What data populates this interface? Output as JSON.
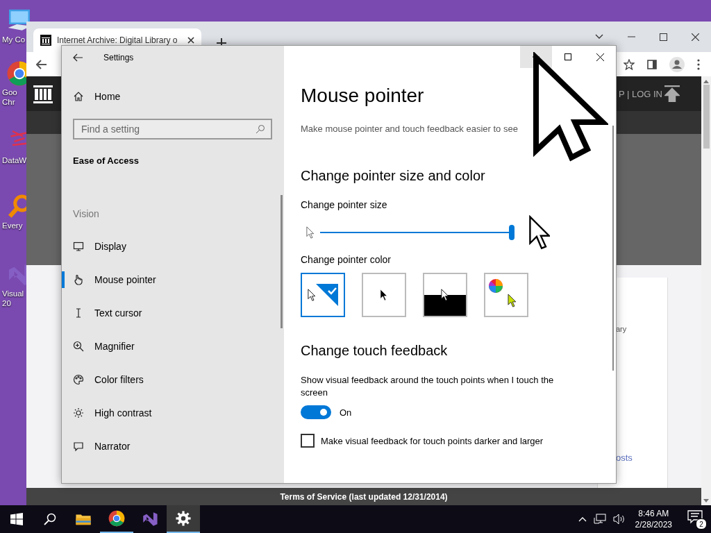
{
  "desktop_icons": [
    {
      "kind": "computer",
      "lines": [
        "My Co"
      ]
    },
    {
      "kind": "browser",
      "lines": [
        "Goo",
        "Chr"
      ]
    },
    {
      "kind": "data",
      "lines": [
        "DataW"
      ]
    },
    {
      "kind": "finder",
      "lines": [
        "Every"
      ]
    },
    {
      "kind": "studio",
      "lines": [
        "Visual",
        "20"
      ]
    }
  ],
  "browser": {
    "tabs": [
      {
        "title": "Internet Archive: Digital Library o",
        "selected": true
      }
    ],
    "header_link": "P | LOG IN",
    "card_text": "ary",
    "card_link": "osts",
    "footer": "Terms of Service (last updated 12/31/2014)"
  },
  "settings": {
    "title": "Settings",
    "home": "Home",
    "search": {
      "placeholder": "Find a setting"
    },
    "category": "Ease of Access",
    "group": "Vision",
    "nav_items": [
      {
        "kind": "display",
        "label": "Display",
        "selected": false
      },
      {
        "kind": "pointer",
        "label": "Mouse pointer",
        "selected": true
      },
      {
        "kind": "cursor",
        "label": "Text cursor",
        "selected": false
      },
      {
        "kind": "magnifier",
        "label": "Magnifier",
        "selected": false
      },
      {
        "kind": "filters",
        "label": "Color filters",
        "selected": false
      },
      {
        "kind": "contrast",
        "label": "High contrast",
        "selected": false
      },
      {
        "kind": "narrator",
        "label": "Narrator",
        "selected": false
      }
    ],
    "heading": "Mouse pointer",
    "description": "Make mouse pointer and touch feedback easier to see",
    "size_section": {
      "title": "Change pointer size and color",
      "size_label": "Change pointer size",
      "size": {
        "level": 1.0
      },
      "color_label": "Change pointer color",
      "colors": [
        {
          "kind": "white",
          "selected": true
        },
        {
          "kind": "black",
          "selected": false
        },
        {
          "kind": "inverted",
          "selected": false
        },
        {
          "kind": "custom",
          "selected": false
        }
      ]
    },
    "touch_section": {
      "title": "Change touch feedback",
      "feedback_label": "Show visual feedback around the touch points when I touch the screen",
      "toggle": {
        "on": true,
        "label": "On"
      },
      "darker": {
        "checked": false,
        "label": "Make visual feedback for touch points darker and larger"
      }
    }
  },
  "taskbar": {
    "apps": [
      {
        "kind": "explorer",
        "running": false,
        "selected": false
      },
      {
        "kind": "browser",
        "running": true,
        "selected": false
      },
      {
        "kind": "studio",
        "running": false,
        "selected": false
      },
      {
        "kind": "settings",
        "running": true,
        "selected": true
      }
    ],
    "time": "8:46 AM",
    "date": "2/28/2023",
    "notifications": "2"
  }
}
